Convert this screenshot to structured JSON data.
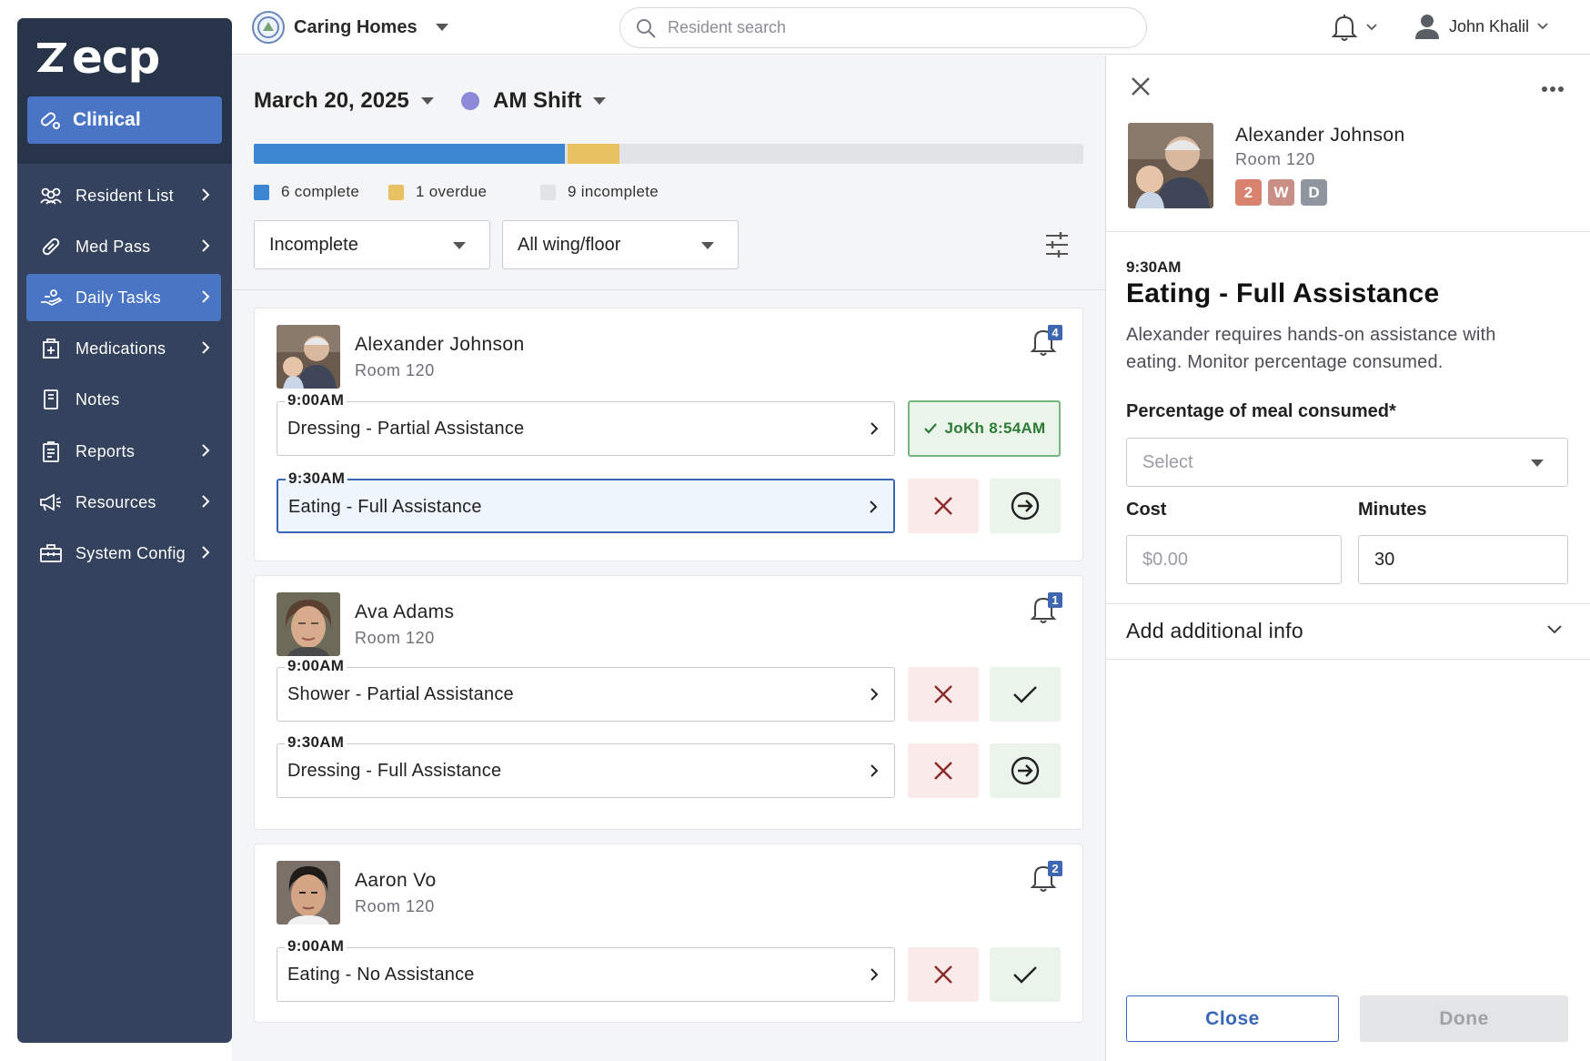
{
  "sidebar": {
    "logo_text": "ecp",
    "module_label": "Clinical",
    "items": [
      {
        "label": "Resident List",
        "icon": "people-icon",
        "has_chevron": true
      },
      {
        "label": "Med Pass",
        "icon": "pill-icon",
        "has_chevron": true
      },
      {
        "label": "Daily Tasks",
        "icon": "hand-care-icon",
        "has_chevron": true,
        "active": true
      },
      {
        "label": "Medications",
        "icon": "medical-kit-icon",
        "has_chevron": true
      },
      {
        "label": "Notes",
        "icon": "notebook-icon",
        "has_chevron": false
      },
      {
        "label": "Reports",
        "icon": "clipboard-icon",
        "has_chevron": true
      },
      {
        "label": "Resources",
        "icon": "megaphone-icon",
        "has_chevron": true
      },
      {
        "label": "System Config",
        "icon": "toolbox-icon",
        "has_chevron": true
      }
    ]
  },
  "topbar": {
    "org_name": "Caring Homes",
    "search_placeholder": "Resident search",
    "user_name": "John Khalil"
  },
  "main": {
    "date": "March 20, 2025",
    "shift": "AM Shift",
    "progress": {
      "complete": 6,
      "overdue": 1,
      "incomplete": 9,
      "total": 16
    },
    "legend": {
      "complete": "6 complete",
      "overdue": "1 overdue",
      "incomplete": "9 incomplete"
    },
    "filters": {
      "status": "Incomplete",
      "wing": "All wing/floor"
    },
    "residents": [
      {
        "name": "Alexander Johnson",
        "room": "Room 120",
        "alerts": "4",
        "tasks": [
          {
            "time": "9:00AM",
            "label": "Dressing - Partial Assistance",
            "done_label": "JoKh 8:54AM"
          },
          {
            "time": "9:30AM",
            "label": "Eating - Full Assistance"
          }
        ]
      },
      {
        "name": "Ava Adams",
        "room": "Room 120",
        "alerts": "1",
        "tasks": [
          {
            "time": "9:00AM",
            "label": "Shower - Partial Assistance"
          },
          {
            "time": "9:30AM",
            "label": "Dressing - Full Assistance"
          }
        ]
      },
      {
        "name": "Aaron Vo",
        "room": "Room 120",
        "alerts": "2",
        "tasks": [
          {
            "time": "9:00AM",
            "label": "Eating - No Assistance"
          }
        ]
      }
    ]
  },
  "panel": {
    "resident_name": "Alexander Johnson",
    "room": "Room 120",
    "tags": [
      {
        "label": "2",
        "color": "#d9826f"
      },
      {
        "label": "W",
        "color": "#c98f86"
      },
      {
        "label": "D",
        "color": "#8f959e"
      }
    ],
    "task_time": "9:30AM",
    "task_title": "Eating - Full Assistance",
    "task_description": "Alexander requires hands-on assistance with eating. Monitor percentage consumed.",
    "percentage_label": "Percentage of meal consumed*",
    "percentage_placeholder": "Select",
    "cost_label": "Cost",
    "cost_placeholder": "$0.00",
    "minutes_label": "Minutes",
    "minutes_value": "30",
    "additional_info_label": "Add additional info",
    "close_button": "Close",
    "done_button": "Done"
  },
  "colors": {
    "sidebar_bg": "#34425d",
    "accent": "#4a74c4",
    "complete": "#3d86d2",
    "overdue": "#e8c163",
    "incomplete": "#e2e3e6",
    "shift_dot": "#8c89d8"
  }
}
